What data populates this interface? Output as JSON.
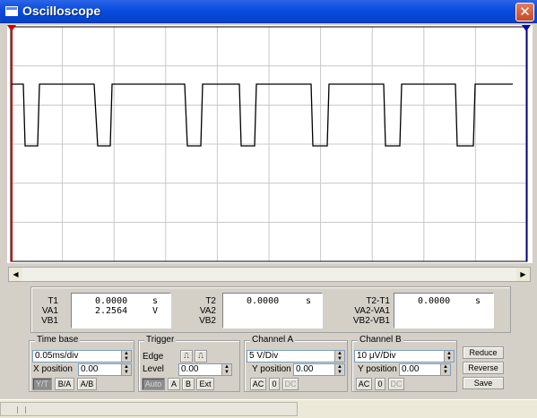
{
  "window": {
    "title": "Oscilloscope",
    "close_glyph": "✕"
  },
  "markers": {
    "t1_color": "#cc0000",
    "t2_color": "#0000cc",
    "t1_label": "1",
    "t2_label": "2"
  },
  "trace": {
    "color": "#000000",
    "grid_color": "#c8c8c8",
    "frame_color": "#cc0000"
  },
  "readout": {
    "t1": {
      "label": "T1",
      "value": "0.0000",
      "unit": "s"
    },
    "va1": {
      "label": "VA1",
      "value": "2.2564",
      "unit": "V"
    },
    "vb1": {
      "label": "VB1",
      "value": "",
      "unit": ""
    },
    "t2": {
      "label": "T2",
      "value": "0.0000",
      "unit": "s"
    },
    "va2": {
      "label": "VA2"
    },
    "vb2": {
      "label": "VB2"
    },
    "t2t1": {
      "label": "T2-T1",
      "value": "0.0000",
      "unit": "s"
    },
    "va2va1": {
      "label": "VA2-VA1"
    },
    "vb2vb1": {
      "label": "VB2-VB1"
    }
  },
  "timebase": {
    "title": "Time base",
    "scale": "0.05ms/div",
    "xpos_label": "X position",
    "xpos_value": "0.00",
    "modes": [
      "Y/T",
      "B/A",
      "A/B"
    ],
    "active_mode": "Y/T"
  },
  "trigger": {
    "title": "Trigger",
    "edge_label": "Edge",
    "level_label": "Level",
    "level_value": "0.00",
    "sources": [
      "Auto",
      "A",
      "B",
      "Ext"
    ],
    "active_source": "Auto"
  },
  "channel_a": {
    "title": "Channel A",
    "scale": "5 V/Div",
    "ypos_label": "Y position",
    "ypos_value": "0.00",
    "coupling": [
      "AC",
      "0",
      "DC"
    ],
    "active_coupling": "DC"
  },
  "channel_b": {
    "title": "Channel B",
    "scale": "10 μV/Div",
    "ypos_label": "Y position",
    "ypos_value": "0.00",
    "coupling": [
      "AC",
      "0",
      "DC"
    ],
    "active_coupling": "DC"
  },
  "actions": {
    "reduce": "Reduce",
    "reverse": "Reverse",
    "save": "Save"
  }
}
